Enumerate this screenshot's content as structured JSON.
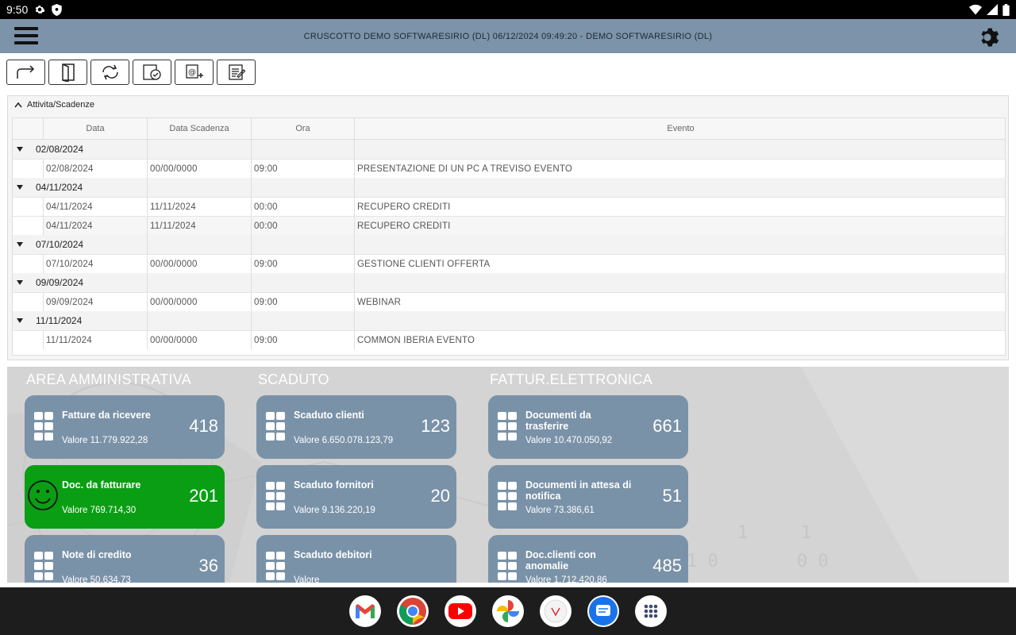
{
  "status_bar": {
    "time": "9:50"
  },
  "appbar": {
    "title": "CRUSCOTTO DEMO SOFTWARESIRIO (DL) 06/12/2024 09:49:20 - DEMO SOFTWARESIRIO (DL)"
  },
  "panel": {
    "title": "Attivita/Scadenze",
    "columns": [
      "Data",
      "Data Scadenza",
      "Ora",
      "Evento"
    ],
    "groups": [
      {
        "label": "02/08/2024",
        "rows": [
          [
            "02/08/2024",
            "00/00/0000",
            "09:00",
            "PRESENTAZIONE DI UN PC A TREVISO EVENTO"
          ]
        ]
      },
      {
        "label": "04/11/2024",
        "rows": [
          [
            "04/11/2024",
            "11/11/2024",
            "00:00",
            "RECUPERO CREDITI"
          ],
          [
            "04/11/2024",
            "11/11/2024",
            "00:00",
            "RECUPERO CREDITI"
          ]
        ]
      },
      {
        "label": "07/10/2024",
        "rows": [
          [
            "07/10/2024",
            "00/00/0000",
            "09:00",
            "GESTIONE CLIENTI OFFERTA"
          ]
        ]
      },
      {
        "label": "09/09/2024",
        "rows": [
          [
            "09/09/2024",
            "00/00/0000",
            "09:00",
            "WEBINAR"
          ]
        ]
      },
      {
        "label": "11/11/2024",
        "rows": [
          [
            "11/11/2024",
            "00/00/0000",
            "09:00",
            "COMMON IBERIA EVENTO"
          ]
        ]
      }
    ]
  },
  "dashboard": {
    "sections": [
      {
        "title": "AREA AMMINISTRATIVA",
        "cards": [
          {
            "title": "Fatture da ricevere",
            "value": "Valore 11.779.922,28",
            "count": "418",
            "style": "blue"
          },
          {
            "title": "Doc. da fatturare",
            "value": "Valore 769.714,30",
            "count": "201",
            "style": "green"
          },
          {
            "title": "Note di credito",
            "value": "Valore 50.634,73",
            "count": "36",
            "style": "blue"
          }
        ]
      },
      {
        "title": "SCADUTO",
        "cards": [
          {
            "title": "Scaduto clienti",
            "value": "Valore 6.650.078.123,79",
            "count": "123",
            "style": "blue"
          },
          {
            "title": "Scaduto fornitori",
            "value": "Valore 9.136.220,19",
            "count": "20",
            "style": "blue"
          },
          {
            "title": "Scaduto debitori",
            "value": "Valore",
            "count": "",
            "style": "blue"
          }
        ]
      },
      {
        "title": "FATTUR.ELETTRONICA",
        "cards": [
          {
            "title": "Documenti da trasferire",
            "value": "Valore 10.470.050,92",
            "count": "661",
            "style": "blue"
          },
          {
            "title": "Documenti in attesa di notifica",
            "value": "Valore 73.386,61",
            "count": "51",
            "style": "blue"
          },
          {
            "title": "Doc.clienti con anomalie",
            "value": "Valore 1.712.420,86",
            "count": "485",
            "style": "blue"
          }
        ]
      }
    ]
  },
  "colors": {
    "appbar": "#7c93a9",
    "card_blue": "#7a92a8",
    "card_green": "#0a9e14"
  },
  "toolbar_icons": [
    "forward-icon",
    "exit-door-icon",
    "refresh-icon",
    "checked-document-icon",
    "email-add-icon",
    "notes-icon"
  ],
  "taskbar_apps": [
    "gmail-icon",
    "chrome-icon",
    "youtube-icon",
    "photos-icon",
    "vivaldi-icon",
    "messages-icon",
    "app-drawer-icon"
  ]
}
